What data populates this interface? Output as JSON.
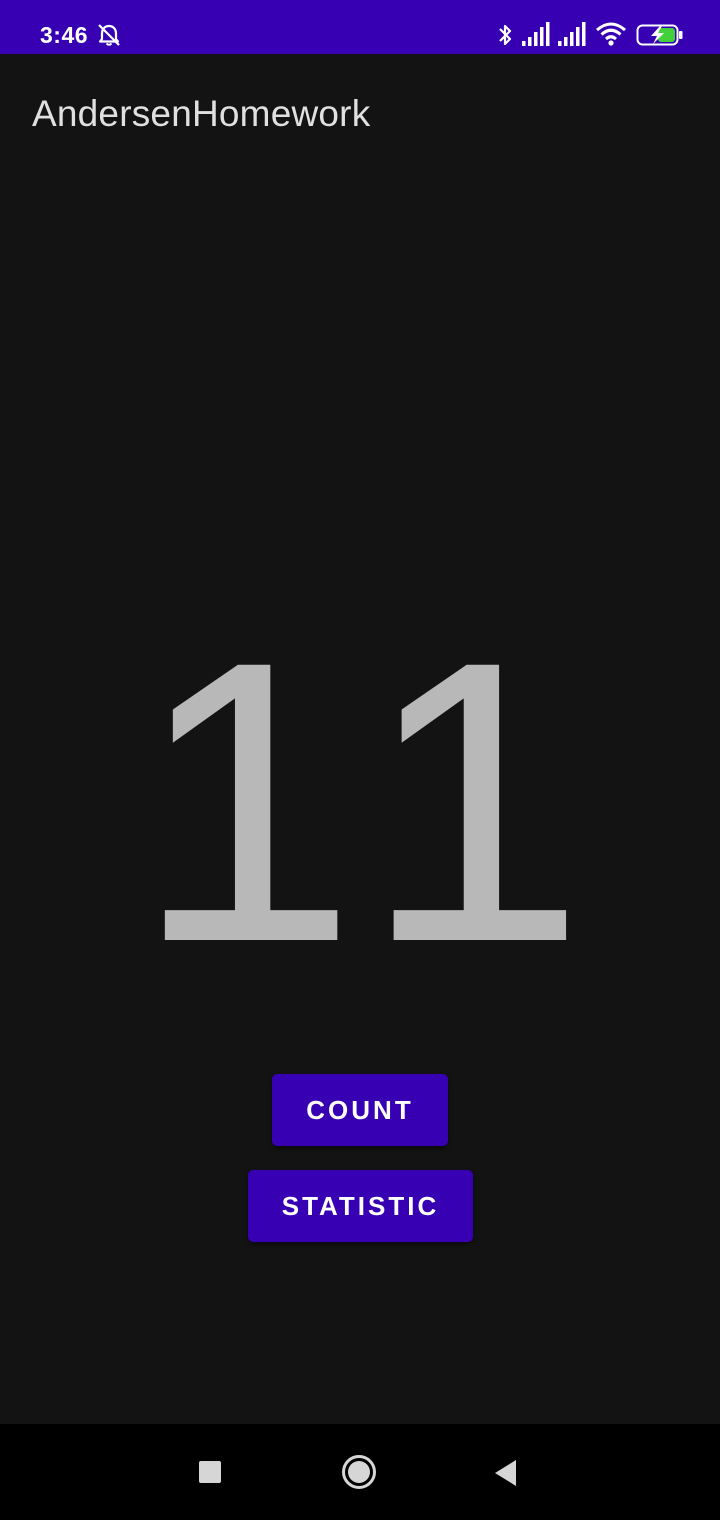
{
  "status_bar": {
    "time": "3:46",
    "icons": [
      "alarm-off-icon",
      "bluetooth-icon",
      "signal-icon",
      "signal-icon",
      "wifi-icon",
      "battery-charging-icon"
    ],
    "background_color": "#3700B3"
  },
  "app_bar": {
    "title": "AndersenHomework"
  },
  "main": {
    "counter_value": "11",
    "buttons": {
      "count_label": "COUNT",
      "statistic_label": "STATISTIC"
    },
    "button_color": "#3700B3"
  },
  "nav_bar": {
    "buttons": [
      "recents-icon",
      "home-icon",
      "back-icon"
    ]
  }
}
